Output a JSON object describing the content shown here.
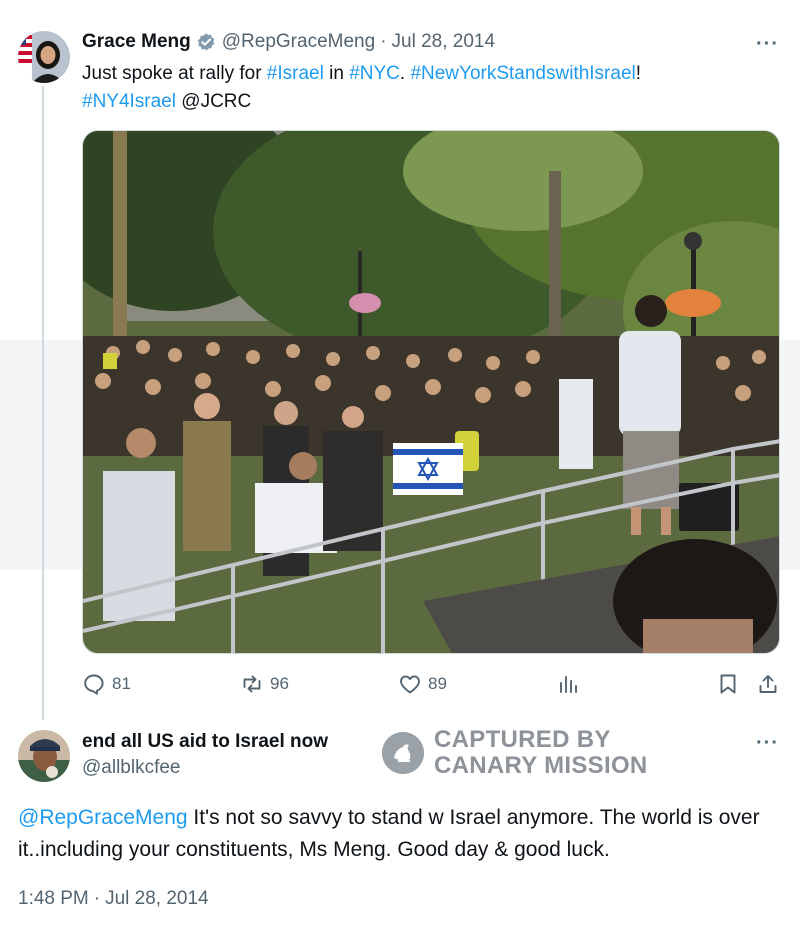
{
  "tweet": {
    "author_name": "Grace Meng",
    "handle": "@RepGraceMeng",
    "separator": "·",
    "date": "Jul 28, 2014",
    "more_label": "···",
    "text": {
      "part1": "Just spoke at rally for ",
      "tag1": "#Israel",
      "part2": " in ",
      "tag2": "#NYC",
      "part3": ". ",
      "tag3": "#NewYorkStandswithIsrael",
      "part4": "!",
      "tag4": "#NY4Israel",
      "part5": " @JCRC"
    },
    "actions": {
      "replies": "81",
      "reposts": "96",
      "likes": "89"
    }
  },
  "reply": {
    "author_name": "end all US aid to Israel now",
    "handle": "@allblkcfee",
    "more_label": "···",
    "mention": "@RepGraceMeng",
    "text": " It's not so savvy to stand w Israel anymore. The world is over it..including your constituents, Ms Meng. Good day & good luck.",
    "time": "1:48 PM",
    "separator": "·",
    "date": "Jul 28, 2014"
  },
  "watermark": {
    "line1": "CAPTURED BY",
    "line2": "CANARY MISSION"
  },
  "colors": {
    "link": "#1d9bf0",
    "muted": "#536471",
    "verified": "#829aab",
    "watermark": "#8d9399"
  },
  "icons": [
    "verified-badge-icon",
    "reply-icon",
    "repost-icon",
    "like-icon",
    "views-icon",
    "bookmark-icon",
    "share-icon",
    "more-icon"
  ]
}
